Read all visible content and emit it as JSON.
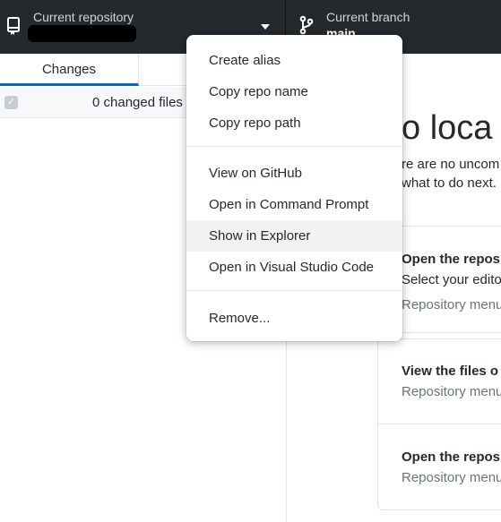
{
  "toolbar": {
    "repository": {
      "label": "Current repository",
      "icon": "repo-icon",
      "dropdown_icon": "caret-down-icon"
    },
    "branch": {
      "label": "Current branch",
      "name": "main",
      "icon": "git-branch-icon"
    }
  },
  "left_pane": {
    "tabs": [
      {
        "label": "Changes",
        "selected": true
      }
    ],
    "changed_files": "0 changed files"
  },
  "right_pane": {
    "title": "o loca",
    "lines": [
      "re are no uncom",
      "what to do next."
    ],
    "cards": [
      {
        "title": "Open the repos",
        "text": "Select your edito",
        "hint": "Repository menu"
      },
      {
        "title": "View the files o",
        "hint": "Repository menu"
      },
      {
        "title": "Open the repos",
        "hint": "Repository menu"
      }
    ]
  },
  "context_menu": {
    "groups": [
      [
        "Create alias",
        "Copy repo name",
        "Copy repo path"
      ],
      [
        "View on GitHub",
        "Open in Command Prompt",
        "Show in Explorer",
        "Open in Visual Studio Code"
      ],
      [
        "Remove..."
      ]
    ],
    "highlighted": "Show in Explorer"
  },
  "colors": {
    "toolbar_bg": "#24292e",
    "accent": "#0366d6",
    "menu_hover": "#f2f2f2"
  }
}
